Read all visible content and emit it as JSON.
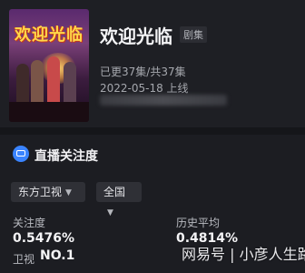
{
  "show": {
    "poster_text": "欢迎光临",
    "title": "欢迎光临",
    "type_badge": "剧集",
    "episodes": "已更37集/共37集",
    "airdate": "2022-05-18 上线"
  },
  "section": {
    "title": "直播关注度"
  },
  "filters": {
    "channel": "东方卫视",
    "region": "全国"
  },
  "stats": {
    "attention_label": "关注度",
    "attention_value": "0.5476%",
    "history_label": "历史平均",
    "history_value": "0.4814%",
    "rank_prefix": "卫视",
    "rank_value": "NO.1"
  },
  "watermark": "网易号 | 小彦人生路",
  "colors": {
    "accent": "#3a84ff",
    "background": "#1c1d22"
  }
}
